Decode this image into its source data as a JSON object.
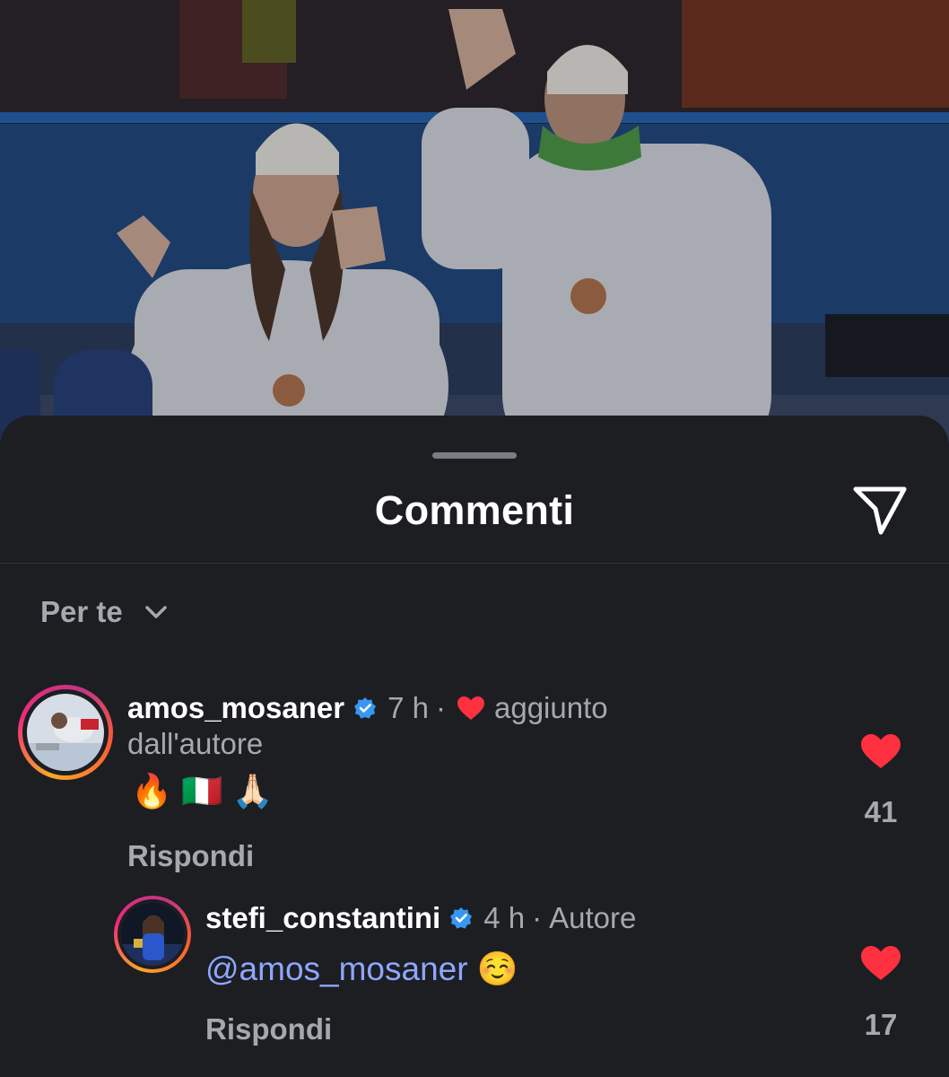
{
  "sheet": {
    "title": "Commenti",
    "sort_label": "Per te"
  },
  "icons": {
    "share": "paper-plane-icon",
    "sort_toggle": "chevron-down-icon",
    "verified": "verified-badge-icon",
    "like": "heart-icon"
  },
  "colors": {
    "sheet_bg": "#1c1e22",
    "like_red": "#ff3040",
    "verified_blue": "#3897f0",
    "mention_blue": "#8fa6ff",
    "muted_text": "#a6a8ad"
  },
  "comments": [
    {
      "username": "amos_mosaner",
      "verified": true,
      "time": "7 h",
      "separator": "·",
      "liked_by_author_label": "aggiunto",
      "liked_by_author_label_cont": "dall'autore",
      "text": "🔥 🇮🇹 🙏🏻",
      "reply_label": "Rispondi",
      "likes": "41",
      "liked": true
    },
    {
      "username": "stefi_constantini",
      "verified": true,
      "time": "4 h",
      "separator": "·",
      "role": "Autore",
      "mention": "@amos_mosaner",
      "text": "☺️",
      "reply_label": "Rispondi",
      "likes": "17",
      "liked": true
    }
  ]
}
